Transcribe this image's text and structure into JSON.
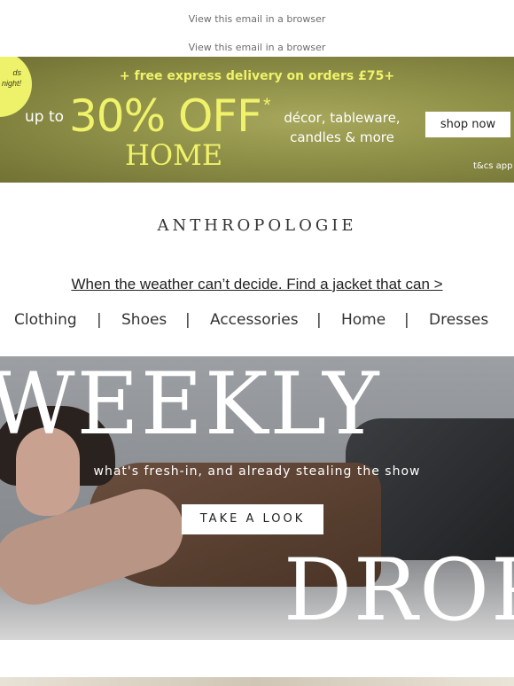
{
  "header": {
    "view_browser_1": "View this email in a browser",
    "view_browser_2": "View this email in a browser"
  },
  "promo": {
    "badge_text": "ds\nnight!",
    "delivery": "+ free express delivery on orders £75+",
    "up_to": "up to",
    "discount": "30% OFF",
    "asterisk": "*",
    "category": "HOME",
    "items": "décor, tableware,\ncandles & more",
    "shop_button": "shop now",
    "terms": "t&cs app",
    "colors": {
      "accent": "#f0f36a",
      "background": "#8f9048"
    }
  },
  "brand": {
    "logo": "ANTHROPOLOGIE"
  },
  "jacket_link": "When the weather can’t decide. Find a jacket that can >",
  "nav": {
    "items": [
      "Clothing",
      "Shoes",
      "Accessories",
      "Home",
      "Dresses"
    ],
    "separator": "|"
  },
  "hero": {
    "title_top": "WEEKLY",
    "tagline": "what's fresh-in, and already stealing the show",
    "cta": "TAKE A LOOK",
    "title_bottom": "DROP"
  }
}
